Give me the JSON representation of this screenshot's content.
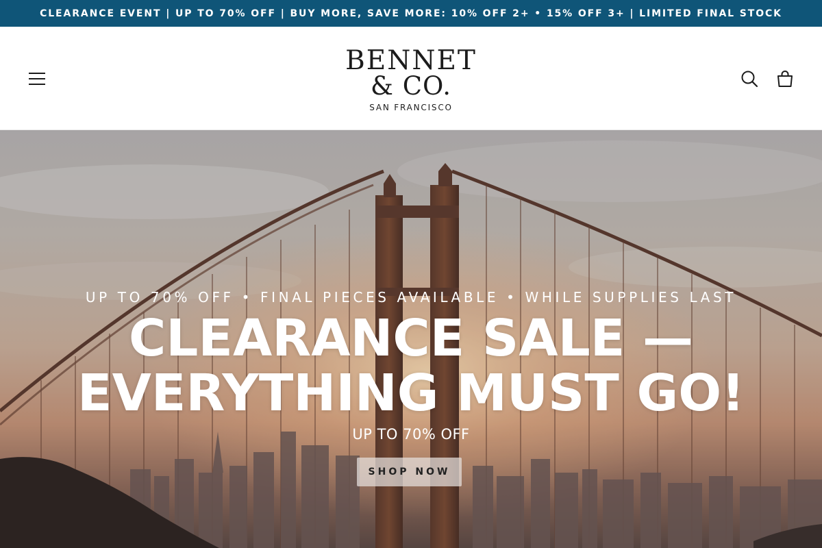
{
  "announcement": {
    "text": "CLEARANCE EVENT | UP TO 70% OFF | BUY MORE, SAVE MORE: 10% OFF 2+ • 15% OFF 3+ | LIMITED FINAL STOCK"
  },
  "header": {
    "logo": {
      "line1": "BENNET",
      "line2": "& CO.",
      "line3": "SAN FRANCISCO"
    },
    "icons": {
      "menu": "menu-icon",
      "search": "search-icon",
      "cart": "cart-icon"
    }
  },
  "hero": {
    "subheading": "UP TO 70% OFF • FINAL PIECES AVAILABLE • WHILE SUPPLIES LAST",
    "title_line1": "CLEARANCE SALE —",
    "title_line2": "EVERYTHING MUST GO!",
    "offer": "UP TO 70% OFF",
    "cta_label": "SHOP NOW"
  },
  "colors": {
    "announcement_bg": "#0f5578",
    "text_dark": "#1c1c1c",
    "white": "#ffffff"
  }
}
